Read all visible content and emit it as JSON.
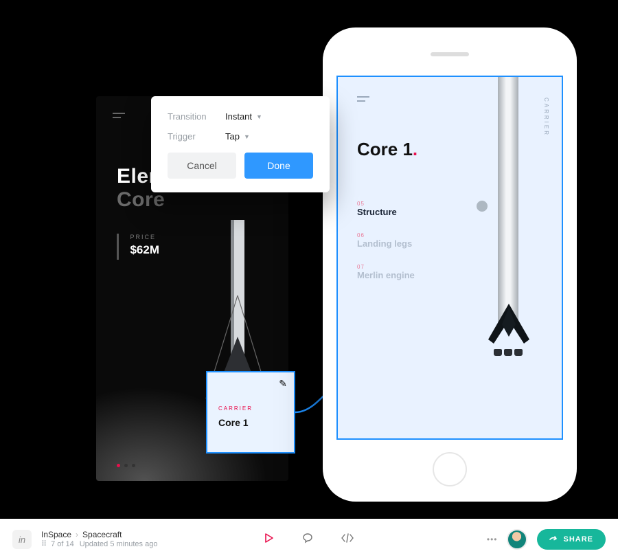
{
  "popover": {
    "transition_label": "Transition",
    "transition_value": "Instant",
    "trigger_label": "Trigger",
    "trigger_value": "Tap",
    "cancel": "Cancel",
    "done": "Done"
  },
  "dark_phone": {
    "heading_line1": "Eleme",
    "heading_line2": "Core",
    "price_label": "PRICE",
    "price_value": "$62M"
  },
  "hotspot": {
    "category": "CARRIER",
    "title": "Core 1"
  },
  "light_phone": {
    "vertical_label": "CARRIER",
    "title": "Core 1",
    "items": [
      {
        "num": "05",
        "label": "Structure",
        "active": true
      },
      {
        "num": "06",
        "label": "Landing legs",
        "active": false
      },
      {
        "num": "07",
        "label": "Merlin engine",
        "active": false
      }
    ]
  },
  "toolbar": {
    "logo": "in",
    "project": "InSpace",
    "page": "Spacecraft",
    "counter": "7 of 14",
    "updated": "Updated 5 minutes ago",
    "share": "SHARE"
  }
}
